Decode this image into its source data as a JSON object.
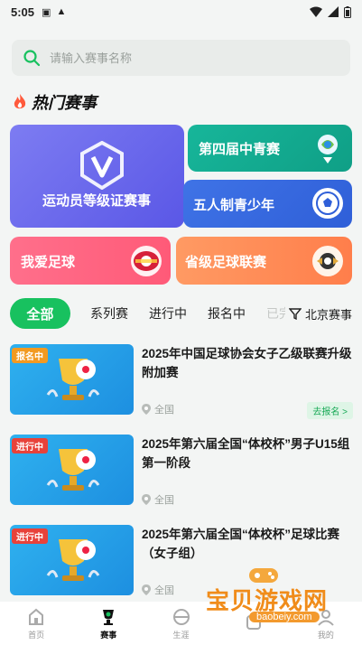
{
  "status": {
    "time": "5:05"
  },
  "search": {
    "placeholder": "请输入赛事名称"
  },
  "hot": {
    "title": "热门赛事"
  },
  "cards": {
    "main": "运动员等级证赛事",
    "fourth": "第四届中青赛",
    "five": "五人制青少年",
    "love": "我爱足球",
    "province": "省级足球联赛"
  },
  "tabs": [
    "全部",
    "系列赛",
    "进行中",
    "报名中",
    "已完"
  ],
  "filter": {
    "label": "北京赛事"
  },
  "events": [
    {
      "tag": "报名中",
      "tag_color": "#f29a21",
      "title": "2025年中国足球协会女子乙级联赛升级附加赛",
      "location": "全国",
      "action": "去报名 >"
    },
    {
      "tag": "进行中",
      "tag_color": "#e8423a",
      "title": "2025年第六届全国“体校杯”男子U15组第一阶段",
      "location": "全国"
    },
    {
      "tag": "进行中",
      "tag_color": "#e8423a",
      "title": "2025年第六届全国“体校杯”足球比赛（女子组）",
      "location": "全国"
    }
  ],
  "nav": [
    {
      "label": "首页",
      "icon": "home-icon"
    },
    {
      "label": "赛事",
      "icon": "trophy-icon"
    },
    {
      "label": "生涯",
      "icon": "career-icon"
    },
    {
      "label": "",
      "icon": "discover-icon"
    },
    {
      "label": "我的",
      "icon": "profile-icon"
    }
  ],
  "watermark": {
    "cn": "宝贝游戏网",
    "url": "baobeiy.com"
  },
  "colors": {
    "accent": "#18c15f"
  }
}
